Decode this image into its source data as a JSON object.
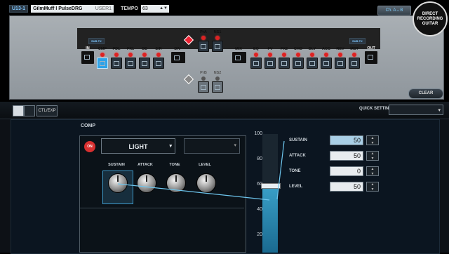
{
  "patch": {
    "id": "U13-1",
    "name": "GilmMuff I PulseDRG",
    "bank": "USER1",
    "tempo_label": "TEMPO",
    "tempo": "63",
    "channel_btn": "Ch. A↔B",
    "clear": "CLEAR"
  },
  "logo": {
    "line1": "DIRECT",
    "line2": "RECORDING",
    "line3": "GUITAR"
  },
  "chain": {
    "in": "IN",
    "out": "OUT",
    "div": "DIV",
    "mix": "MIX",
    "sub_badge": "SUB FX",
    "top_blocks": [
      "CMP",
      "PDL",
      "FX1",
      "OD",
      "S/R"
    ],
    "post_blocks": [
      "EQ",
      "FV",
      "FX2",
      "CHO",
      "DLY",
      "ACC",
      "REV",
      "MST"
    ],
    "pra": [
      "PrA",
      "NS1"
    ],
    "prb": [
      "PrB",
      "NS2"
    ]
  },
  "toolbar": {
    "ctl": "CTL/EXP",
    "quick_setting": "QUICK SETTING"
  },
  "comp": {
    "section": "COMP",
    "on": "ON",
    "type": "LIGHT",
    "knobs": [
      "SUSTAIN",
      "ATTACK",
      "TONE",
      "LEVEL"
    ],
    "slider_ticks": [
      "100",
      "80",
      "60",
      "40",
      "20"
    ],
    "slider_level": 0.5,
    "params": [
      {
        "name": "SUSTAIN",
        "value": "50"
      },
      {
        "name": "ATTACK",
        "value": "50"
      },
      {
        "name": "TONE",
        "value": "0"
      },
      {
        "name": "LEVEL",
        "value": "50"
      }
    ]
  },
  "colors": {
    "accent": "#2ea3e8",
    "led": "#d22222"
  }
}
